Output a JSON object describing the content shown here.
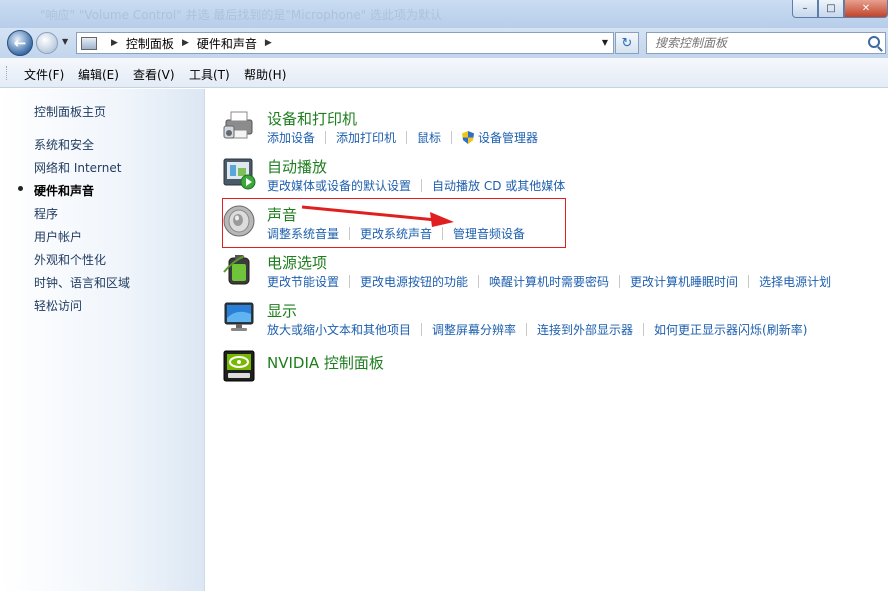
{
  "titlebar": {
    "ghost_text": "\"响应\"  \"Volume Control\"  并选   最后找到的是\"Microphone\"  选此项为默认",
    "minimize": "–",
    "maximize": "□",
    "close": "✕"
  },
  "navbar": {
    "breadcrumb": [
      "控制面板",
      "硬件和声音"
    ],
    "search_placeholder": "搜索控制面板"
  },
  "menu": [
    {
      "label": "文件(F)"
    },
    {
      "label": "编辑(E)"
    },
    {
      "label": "查看(V)"
    },
    {
      "label": "工具(T)"
    },
    {
      "label": "帮助(H)"
    }
  ],
  "sidebar": {
    "home": "控制面板主页",
    "items": [
      {
        "label": "系统和安全"
      },
      {
        "label": "网络和 Internet"
      },
      {
        "label": "硬件和声音"
      },
      {
        "label": "程序"
      },
      {
        "label": "用户帐户"
      },
      {
        "label": "外观和个性化"
      },
      {
        "label": "时钟、语言和区域"
      },
      {
        "label": "轻松访问"
      }
    ]
  },
  "categories": [
    {
      "title": "设备和打印机",
      "icon": "printer-icon",
      "links": [
        "添加设备",
        "添加打印机",
        "鼠标",
        "设备管理器"
      ]
    },
    {
      "title": "自动播放",
      "icon": "autoplay-icon",
      "links": [
        "更改媒体或设备的默认设置",
        "自动播放 CD 或其他媒体"
      ]
    },
    {
      "title": "声音",
      "icon": "speaker-icon",
      "links": [
        "调整系统音量",
        "更改系统声音",
        "管理音频设备"
      ]
    },
    {
      "title": "电源选项",
      "icon": "battery-icon",
      "links": [
        "更改节能设置",
        "更改电源按钮的功能",
        "唤醒计算机时需要密码",
        "更改计算机睡眠时间",
        "选择电源计划"
      ]
    },
    {
      "title": "显示",
      "icon": "monitor-icon",
      "links": [
        "放大或缩小文本和其他项目",
        "调整屏幕分辨率",
        "连接到外部显示器",
        "如何更正显示器闪烁(刷新率)"
      ]
    },
    {
      "title": "NVIDIA 控制面板",
      "icon": "nvidia-icon",
      "links": []
    }
  ],
  "colors": {
    "category_title": "#1e7e1e",
    "link": "#1d5fae",
    "highlight": "#e02020"
  }
}
